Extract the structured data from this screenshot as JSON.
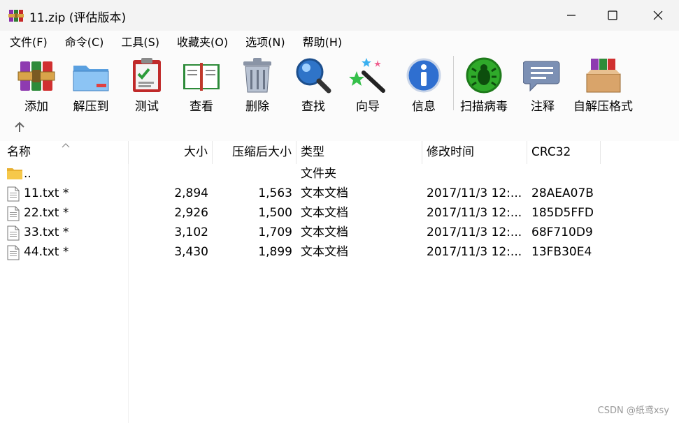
{
  "window": {
    "title": "11.zip (评估版本)"
  },
  "menu": [
    "文件(F)",
    "命令(C)",
    "工具(S)",
    "收藏夹(O)",
    "选项(N)",
    "帮助(H)"
  ],
  "toolbar": {
    "add": "添加",
    "extract": "解压到",
    "test": "测试",
    "view": "查看",
    "delete": "删除",
    "find": "查找",
    "wizard": "向导",
    "info": "信息",
    "scan": "扫描病毒",
    "comment": "注释",
    "sfx": "自解压格式"
  },
  "columns": {
    "name": "名称",
    "size": "大小",
    "packed": "压缩后大小",
    "type": "类型",
    "modified": "修改时间",
    "crc": "CRC32"
  },
  "parent": {
    "name": "..",
    "type": "文件夹"
  },
  "files": [
    {
      "name": "11.txt *",
      "size": "2,894",
      "packed": "1,563",
      "type": "文本文档",
      "modified": "2017/11/3 12:...",
      "crc": "28AEA07B"
    },
    {
      "name": "22.txt *",
      "size": "2,926",
      "packed": "1,500",
      "type": "文本文档",
      "modified": "2017/11/3 12:...",
      "crc": "185D5FFD"
    },
    {
      "name": "33.txt *",
      "size": "3,102",
      "packed": "1,709",
      "type": "文本文档",
      "modified": "2017/11/3 12:...",
      "crc": "68F710D9"
    },
    {
      "name": "44.txt *",
      "size": "3,430",
      "packed": "1,899",
      "type": "文本文档",
      "modified": "2017/11/3 12:...",
      "crc": "13FB30E4"
    }
  ],
  "watermark": "CSDN @纸鸢xsy"
}
